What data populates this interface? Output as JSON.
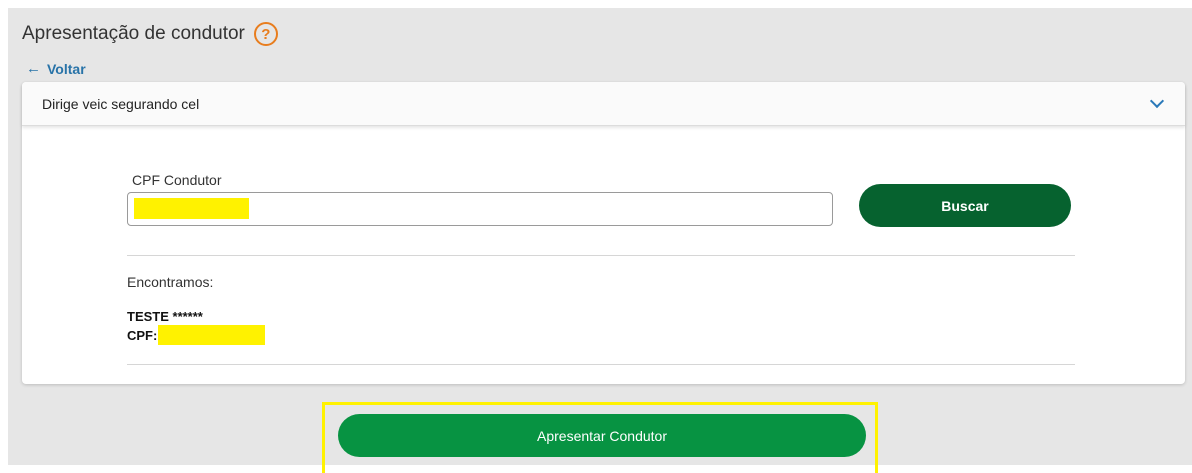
{
  "header": {
    "title": "Apresentação de condutor",
    "help_glyph": "?",
    "help_icon": "question-circle-icon",
    "back_arrow": "←",
    "back_label": "Voltar"
  },
  "accordion": {
    "label": "Dirige veic segurando cel",
    "icon": "chevron-down-icon"
  },
  "search": {
    "field_label": "CPF Condutor",
    "value": "",
    "button_label": "Buscar"
  },
  "result": {
    "found_label": "Encontramos:",
    "name": "TESTE ******",
    "cpf_label": "CPF:"
  },
  "footer": {
    "submit_label": "Apresentar Condutor"
  },
  "colors": {
    "primary_dark_green": "#06622f",
    "primary_green": "#079342",
    "help_orange": "#e87d1e",
    "link_blue": "#2873a8",
    "redaction_yellow": "#fff200"
  }
}
